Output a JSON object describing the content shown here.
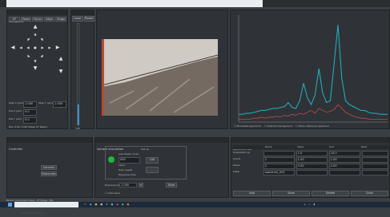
{
  "window": {
    "top_label": "Navigation",
    "close_glyph": "×"
  },
  "nav": {
    "tabs": [
      "XY",
      "Zoom",
      "Focus",
      "Align",
      "Stage"
    ],
    "fields": [
      {
        "label": "Step X (µm)",
        "value": "1.000"
      },
      {
        "label": "Step Y (µm)",
        "value": "1.000"
      },
      {
        "label": "Pos X (µm)",
        "value": "0.0"
      },
      {
        "label": "Pos Y (µm)",
        "value": "0.0"
      }
    ],
    "status": "Pos: 0.00 / 0.00  Stage XY  Ready"
  },
  "slider_panel": {
    "tabs": [
      "Laser",
      "Power"
    ],
    "value": "100"
  },
  "image_view": {
    "label": "Camera"
  },
  "spectrum": {
    "options": [
      "Normalize spectrum",
      "Subtract background",
      "Show reference spectrum"
    ]
  },
  "controller": {
    "title": "Controller",
    "connect_label": "Connect",
    "disconnect_label": "Disconnect"
  },
  "acquisition": {
    "title": "Sample acquisition",
    "header": "Set up",
    "items": [
      "Live Mode / Scan",
      "Laser",
      "Scan speed",
      "Exposure time"
    ],
    "values": [
      "000",
      "100"
    ],
    "bottom_label": "Exposure (ms)",
    "bottom_value": "1.000",
    "save_label": "Save",
    "checkbox_label": "Auto save"
  },
  "table_panel": {
    "title": "Spectrum list",
    "columns": [
      "",
      "Name",
      "Value",
      "Unit",
      "Note"
    ],
    "rows": [
      [
        "Acquisition (s)",
        "",
        "1.0",
        "10.0",
        ""
      ],
      [
        "Count",
        "1",
        "1.00",
        "1.00",
        ""
      ],
      [
        "Power",
        "2",
        "2.00",
        "2.00",
        ""
      ],
      [
        "Label",
        "spectrum_001",
        "",
        "",
        ""
      ]
    ],
    "buttons": [
      "Add",
      "Save",
      "Delete",
      "Clear"
    ]
  },
  "taskbar": {
    "search_placeholder": "Type here to search",
    "status_text": "Ready  Connected  Laser: off  Stage: idle"
  },
  "chart_data": {
    "type": "line",
    "title": "",
    "xlabel": "",
    "ylabel": "",
    "series": [
      {
        "name": "",
        "color": "#22b5c4",
        "values": [
          8,
          8,
          9,
          9,
          10,
          11,
          12,
          12,
          13,
          14,
          14,
          15,
          16,
          20,
          15,
          14,
          22,
          40,
          25,
          18,
          28,
          55,
          30,
          20,
          22,
          60,
          100,
          45,
          22,
          18,
          16,
          14,
          12,
          12,
          10,
          9,
          9,
          8,
          8,
          8
        ]
      },
      {
        "name": "",
        "color": "#d05050",
        "values": [
          3,
          3,
          3,
          3,
          4,
          4,
          5,
          4,
          5,
          5,
          6,
          5,
          7,
          6,
          8,
          7,
          9,
          8,
          10,
          12,
          9,
          14,
          12,
          10,
          11,
          13,
          18,
          14,
          10,
          8,
          6,
          5,
          4,
          4,
          3,
          3,
          3,
          3,
          3,
          3
        ]
      }
    ],
    "ylim": [
      0,
      110
    ],
    "grid": false
  }
}
